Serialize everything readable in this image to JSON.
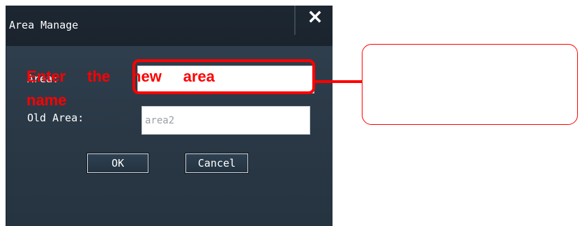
{
  "dialog": {
    "title": "Area Manage",
    "close_label": "x",
    "area_label": "Area:",
    "area_value": "",
    "old_area_label": "Old Area:",
    "old_area_value": "area2",
    "ok_label": "OK",
    "cancel_label": "Cancel"
  },
  "annotation": {
    "text": "Enter the new area name",
    "color": "#ff0000"
  },
  "colors": {
    "dialog_bg": "#2b3947",
    "titlebar_bg": "#1c252f",
    "highlight": "#ff0000"
  }
}
